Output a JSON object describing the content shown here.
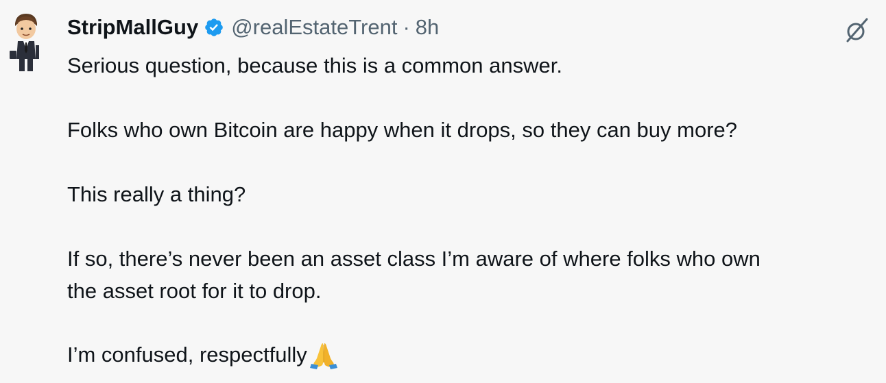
{
  "tweet": {
    "author": {
      "display_name": "StripMallGuy",
      "handle": "@realEstateTrent",
      "verified": true
    },
    "separator": "·",
    "time": "8h",
    "icons": {
      "avatar": "avatar-man-in-suit",
      "verified_badge": "verified-badge-icon",
      "grok": "grok-slash-icon",
      "emoji": "folded-hands-emoji"
    },
    "text": {
      "p1": "Serious question, because this is a common answer.",
      "p2": "Folks who own Bitcoin are happy when it drops, so they can buy more?",
      "p3": "This really a thing?",
      "p4_line1": "If so, there’s never been an asset class I’m aware of where folks who own",
      "p4_line2": "the asset root for it to drop.",
      "p5": "I’m confused, respectfully"
    },
    "colors": {
      "background": "#f7f7f7",
      "text": "#0f1419",
      "secondary": "#536471",
      "verified_blue": "#1d9bf0"
    }
  }
}
